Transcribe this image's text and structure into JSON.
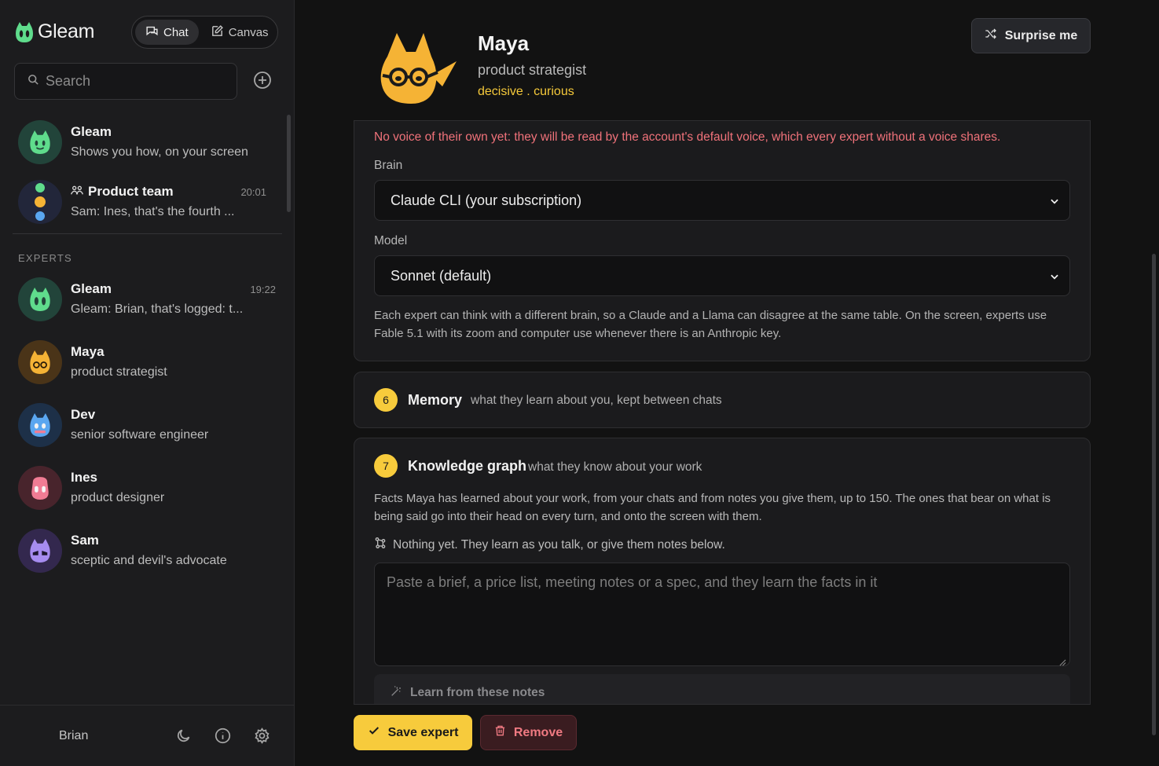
{
  "brand": {
    "name": "Gleam"
  },
  "mode_toggle": {
    "chat": "Chat",
    "canvas": "Canvas"
  },
  "search": {
    "placeholder": "Search"
  },
  "conversations": [
    {
      "title": "Gleam",
      "subtitle": "Shows you how, on your screen",
      "time": ""
    },
    {
      "title": "Product team",
      "subtitle": "Sam: Ines, that's the fourth ...",
      "time": "20:01"
    }
  ],
  "experts_section": {
    "label": "EXPERTS"
  },
  "experts": [
    {
      "name": "Gleam",
      "subtitle": "Gleam: Brian, that's logged: t...",
      "time": "19:22",
      "color": "#5fdc8c"
    },
    {
      "name": "Maya",
      "subtitle": "product strategist",
      "time": "",
      "color": "#f5b335"
    },
    {
      "name": "Dev",
      "subtitle": "senior software engineer",
      "time": "",
      "color": "#5aa6f0"
    },
    {
      "name": "Ines",
      "subtitle": "product designer",
      "time": "",
      "color": "#f07c94"
    },
    {
      "name": "Sam",
      "subtitle": "sceptic and devil's advocate",
      "time": "",
      "color": "#a68cf0"
    }
  ],
  "footer": {
    "user": "Brian"
  },
  "profile": {
    "name": "Maya",
    "role": "product strategist",
    "traits": "decisive . curious",
    "surprise_label": "Surprise me"
  },
  "voice_card": {
    "warning": "No voice of their own yet: they will be read by the account's default voice, which every expert without a voice shares.",
    "brain_label": "Brain",
    "brain_value": "Claude CLI (your subscription)",
    "model_label": "Model",
    "model_value": "Sonnet (default)",
    "note": "Each expert can think with a different brain, so a Claude and a Llama can disagree at the same table. On the screen, experts use Fable 5.1 with its zoom and computer use whenever there is an Anthropic key."
  },
  "memory_card": {
    "step": "6",
    "title": "Memory",
    "subtitle": "what they learn about you, kept between chats"
  },
  "graph_card": {
    "step": "7",
    "title": "Knowledge graph",
    "subtitle": "what they know about your work",
    "description": "Facts Maya has learned about your work, from your chats and from notes you give them, up to 150. The ones that bear on what is being said go into their head on every turn, and onto the screen with them.",
    "empty": "Nothing yet. They learn as you talk, or give them notes below.",
    "notes_placeholder": "Paste a brief, a price list, meeting notes or a spec, and they learn the facts in it",
    "learn_label": "Learn from these notes"
  },
  "actions": {
    "save": "Save expert",
    "remove": "Remove"
  },
  "colors": {
    "accent": "#f7cb3c",
    "danger": "#f07a82",
    "warning_text": "#f0727a"
  }
}
